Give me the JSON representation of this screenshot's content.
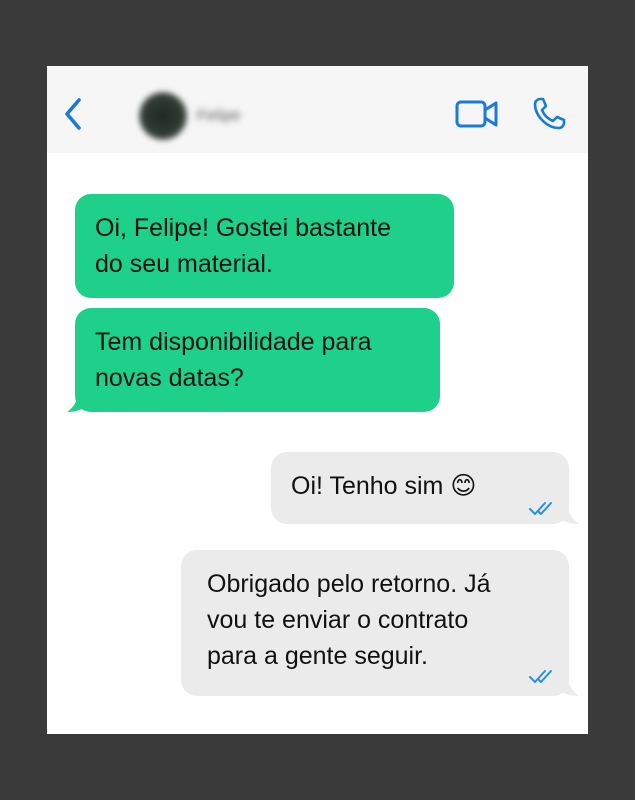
{
  "header": {
    "contact_name": "Felipe",
    "back_icon": "chevron-left-icon",
    "video_icon": "video-camera-icon",
    "call_icon": "phone-icon",
    "accent_color": "#1a7ad4"
  },
  "messages": [
    {
      "direction": "incoming",
      "text": "Oi, Felipe! Gostei bastante\ndo seu material."
    },
    {
      "direction": "incoming",
      "text": "Tem disponibilidade para\nnovas datas?"
    },
    {
      "direction": "outgoing",
      "text": "Oi! Tenho sim 😊",
      "status": "read"
    },
    {
      "direction": "outgoing",
      "text": "Obrigado pelo retorno. Já\nvou te enviar o contrato\npara a gente seguir.",
      "status": "read"
    }
  ],
  "colors": {
    "incoming_bubble": "#1fd08a",
    "outgoing_bubble": "#ebebeb",
    "read_check": "#2a8fe0"
  }
}
